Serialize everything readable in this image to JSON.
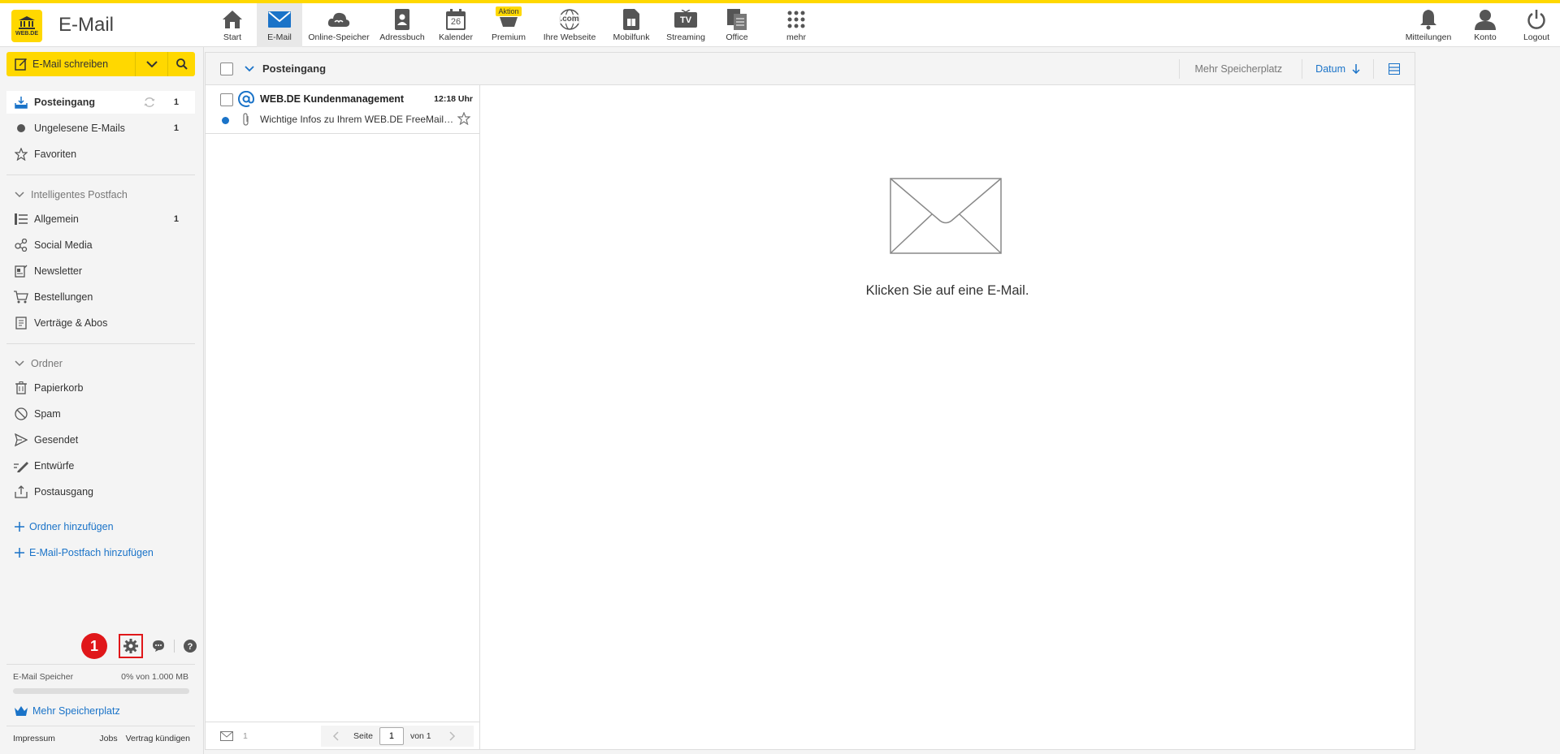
{
  "app": {
    "title": "E-Mail",
    "logo_text": "WEB.DE"
  },
  "nav": {
    "items": [
      {
        "label": "Start",
        "icon": "home-icon"
      },
      {
        "label": "E-Mail",
        "icon": "mail-icon",
        "active": true
      },
      {
        "label": "Online-Speicher",
        "icon": "cloud-icon"
      },
      {
        "label": "Adressbuch",
        "icon": "addressbook-icon"
      },
      {
        "label": "Kalender",
        "icon": "calendar-icon",
        "day": "26"
      },
      {
        "label": "Premium",
        "icon": "premium-icon",
        "badge": "Aktion"
      },
      {
        "label": "Ihre Webseite",
        "icon": "globe-icon",
        "sub": ".com"
      },
      {
        "label": "Mobilfunk",
        "icon": "simcard-icon"
      },
      {
        "label": "Streaming",
        "icon": "tv-icon",
        "sub": "TV"
      },
      {
        "label": "Office",
        "icon": "office-icon"
      },
      {
        "label": "mehr",
        "icon": "grid-icon"
      }
    ],
    "right": [
      {
        "label": "Mitteilungen",
        "icon": "bell-icon"
      },
      {
        "label": "Konto",
        "icon": "user-icon"
      },
      {
        "label": "Logout",
        "icon": "power-icon"
      }
    ]
  },
  "sidebar": {
    "compose_label": "E-Mail schreiben",
    "folders_top": [
      {
        "label": "Posteingang",
        "count": "1",
        "icon": "inbox-icon"
      },
      {
        "label": "Ungelesene E-Mails",
        "count": "1",
        "icon": "dot-icon"
      },
      {
        "label": "Favoriten",
        "count": "",
        "icon": "star-icon"
      }
    ],
    "smart_title": "Intelligentes Postfach",
    "smart": [
      {
        "label": "Allgemein",
        "count": "1",
        "icon": "list-icon"
      },
      {
        "label": "Social Media",
        "count": "",
        "icon": "social-icon"
      },
      {
        "label": "Newsletter",
        "count": "",
        "icon": "newsletter-icon"
      },
      {
        "label": "Bestellungen",
        "count": "",
        "icon": "cart-icon"
      },
      {
        "label": "Verträge & Abos",
        "count": "",
        "icon": "contract-icon"
      }
    ],
    "folders_title": "Ordner",
    "folders": [
      {
        "label": "Papierkorb",
        "icon": "trash-icon"
      },
      {
        "label": "Spam",
        "icon": "spam-icon"
      },
      {
        "label": "Gesendet",
        "icon": "send-icon"
      },
      {
        "label": "Entwürfe",
        "icon": "draft-icon"
      },
      {
        "label": "Postausgang",
        "icon": "outbox-icon"
      }
    ],
    "add_folder": "Ordner hinzufügen",
    "add_mailbox": "E-Mail-Postfach hinzufügen",
    "step_badge": "1",
    "storage_label": "E-Mail Speicher",
    "storage_value": "0% von 1.000 MB",
    "storage_fraction": 0.0,
    "more_storage": "Mehr Speicherplatz",
    "footer": {
      "impressum": "Impressum",
      "jobs": "Jobs",
      "cancel": "Vertrag kündigen"
    }
  },
  "list": {
    "title": "Posteingang",
    "more_storage": "Mehr Speicherplatz",
    "sort_label": "Datum",
    "messages": [
      {
        "sender": "WEB.DE Kundenmanagement",
        "time": "12:18 Uhr",
        "subject": "Wichtige Infos zu Ihrem WEB.DE FreeMail-Postfach",
        "unread": true
      }
    ],
    "footer_count": "1",
    "page_label": "Seite",
    "page_value": "1",
    "page_of": "von 1"
  },
  "reading": {
    "empty_text": "Klicken Sie auf eine E-Mail."
  },
  "colors": {
    "brand": "#ffd800",
    "link": "#1a73c8",
    "alert": "#e0171a"
  }
}
